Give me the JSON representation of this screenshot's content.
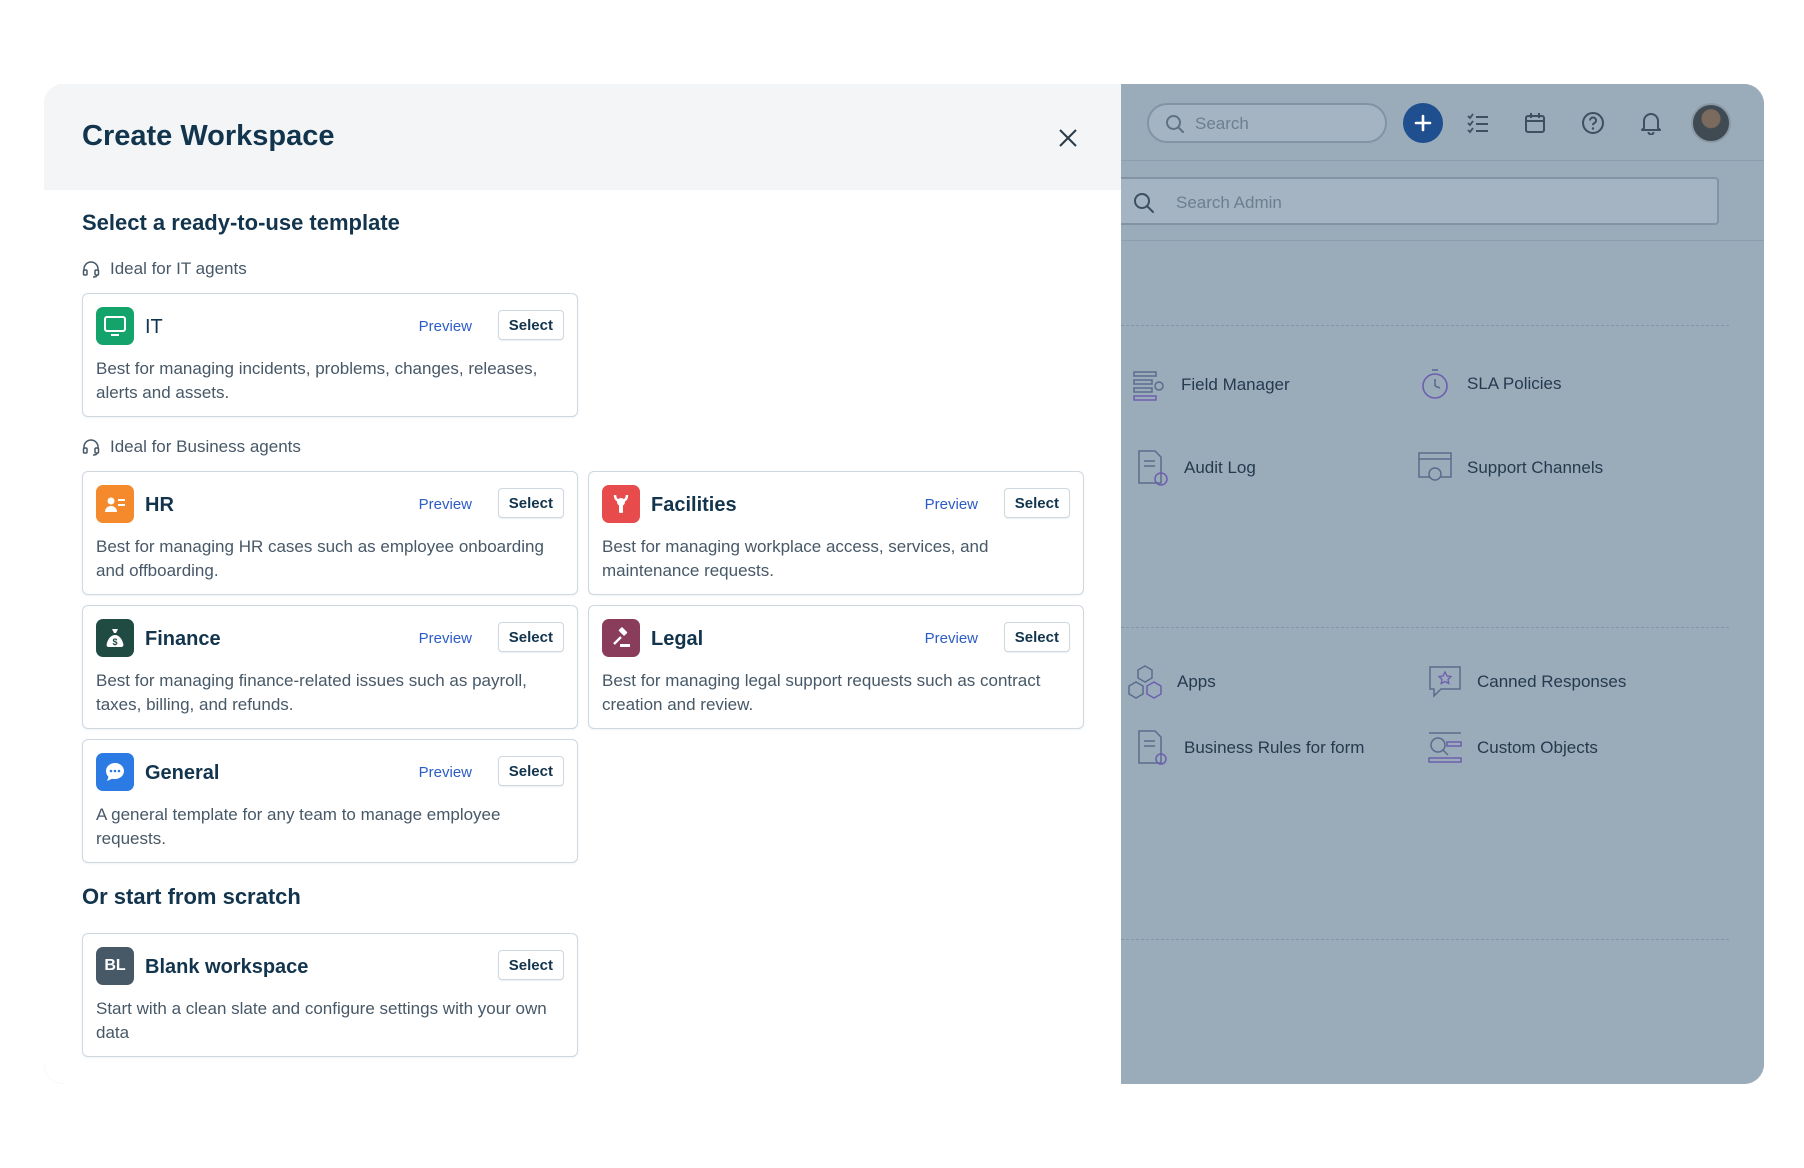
{
  "modal": {
    "title": "Create Workspace",
    "template_heading": "Select a ready-to-use template",
    "it_hint": "Ideal for IT agents",
    "business_hint": "Ideal for Business agents",
    "scratch_heading": "Or start from scratch",
    "preview_label": "Preview",
    "select_label": "Select",
    "templates": {
      "it": {
        "name": "IT",
        "desc": "Best for managing incidents, problems, changes, releases, alerts and assets.",
        "icon": "monitor-icon",
        "color": "#14a46b"
      },
      "hr": {
        "name": "HR",
        "desc": "Best for managing HR cases such as employee onboarding and offboarding.",
        "icon": "id-card-icon",
        "color": "#f48a2c"
      },
      "facilities": {
        "name": "Facilities",
        "desc": "Best for managing workplace access, services, and maintenance requests.",
        "icon": "wrench-icon",
        "color": "#e84b4b"
      },
      "finance": {
        "name": "Finance",
        "desc": "Best for managing finance-related issues such as payroll, taxes, billing, and refunds.",
        "icon": "money-bag-icon",
        "color": "#1f4b43"
      },
      "legal": {
        "name": "Legal",
        "desc": "Best for managing legal support requests such as contract creation and review.",
        "icon": "gavel-icon",
        "color": "#8a3d5b"
      },
      "general": {
        "name": "General",
        "desc": "A general template for any team to manage employee requests.",
        "icon": "chat-bubble-icon",
        "color": "#2c7be5"
      }
    },
    "blank": {
      "badge": "BL",
      "name": "Blank workspace",
      "desc": "Start with a clean slate and configure settings with your own data"
    }
  },
  "admin": {
    "global_search_placeholder": "Search",
    "admin_search_placeholder": "Search Admin",
    "items": {
      "field_manager": "Field Manager",
      "sla_policies": "SLA Policies",
      "audit_log": "Audit Log",
      "support_channels": "Support Channels",
      "apps": "Apps",
      "canned_responses": "Canned Responses",
      "business_rules": "Business Rules for form",
      "custom_objects": "Custom Objects"
    }
  }
}
